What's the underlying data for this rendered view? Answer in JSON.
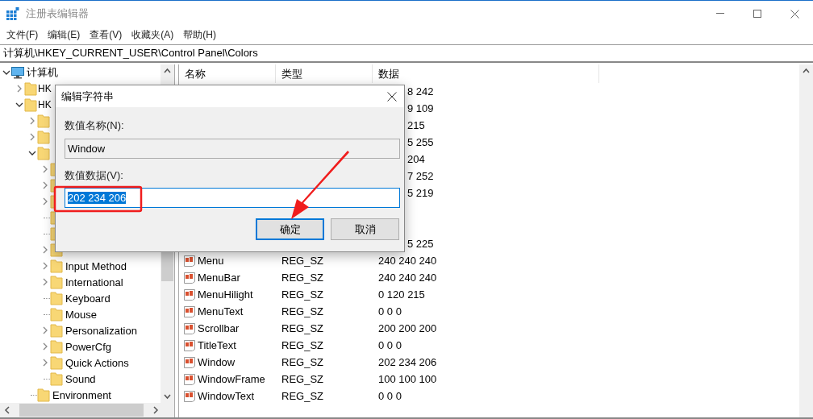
{
  "window": {
    "title": "注册表编辑器"
  },
  "menu": [
    "文件(F)",
    "编辑(E)",
    "查看(V)",
    "收藏夹(A)",
    "帮助(H)"
  ],
  "address": "计算机\\HKEY_CURRENT_USER\\Control Panel\\Colors",
  "tree": {
    "label": "计算机",
    "kind": "folder",
    "expanded": true,
    "children": [
      {
        "label": "HK",
        "kind": "folder",
        "expanded": false
      },
      {
        "label": "HK",
        "kind": "folder",
        "expanded": true,
        "children": [
          {
            "kind": "folder",
            "expanded": false
          },
          {
            "kind": "folder",
            "expanded": false
          },
          {
            "kind": "folder",
            "expanded": true,
            "children": [
              {
                "kind": "folder",
                "expanded": false
              },
              {
                "kind": "folder",
                "expanded": false
              },
              {
                "kind": "folder",
                "expanded": false
              },
              {
                "kind": "leaf"
              },
              {
                "kind": "leaf"
              },
              {
                "kind": "folder",
                "expanded": false
              },
              {
                "label": "Input Method",
                "kind": "folder",
                "expanded": false
              },
              {
                "label": "International",
                "kind": "folder",
                "expanded": false
              },
              {
                "label": "Keyboard",
                "kind": "leaf"
              },
              {
                "label": "Mouse",
                "kind": "leaf"
              },
              {
                "label": "Personalization",
                "kind": "folder",
                "expanded": false
              },
              {
                "label": "PowerCfg",
                "kind": "folder",
                "expanded": false
              },
              {
                "label": "Quick Actions",
                "kind": "folder",
                "expanded": false
              },
              {
                "label": "Sound",
                "kind": "leaf"
              }
            ]
          },
          {
            "label": "Environment",
            "kind": "leaf"
          }
        ]
      }
    ]
  },
  "list": {
    "columns": [
      "名称",
      "类型",
      "数据"
    ],
    "rows": [
      {
        "data": "8 242"
      },
      {
        "data": "9 109"
      },
      {
        "data": "215"
      },
      {
        "data": "5 255"
      },
      {
        "data": "204"
      },
      {
        "data": "7 252"
      },
      {
        "data": "5 219"
      },
      {},
      {},
      {
        "data": "5 225"
      },
      {
        "name": "Menu",
        "type": "REG_SZ",
        "data": "240 240 240"
      },
      {
        "name": "MenuBar",
        "type": "REG_SZ",
        "data": "240 240 240"
      },
      {
        "name": "MenuHilight",
        "type": "REG_SZ",
        "data": "0 120 215"
      },
      {
        "name": "MenuText",
        "type": "REG_SZ",
        "data": "0 0 0"
      },
      {
        "name": "Scrollbar",
        "type": "REG_SZ",
        "data": "200 200 200"
      },
      {
        "name": "TitleText",
        "type": "REG_SZ",
        "data": "0 0 0"
      },
      {
        "name": "Window",
        "type": "REG_SZ",
        "data": "202 234 206"
      },
      {
        "name": "WindowFrame",
        "type": "REG_SZ",
        "data": "100 100 100"
      },
      {
        "name": "WindowText",
        "type": "REG_SZ",
        "data": "0 0 0"
      }
    ]
  },
  "dialog": {
    "title": "编辑字符串",
    "name_label": "数值名称(N):",
    "name_value": "Window",
    "data_label": "数值数据(V):",
    "data_value": "202 234 206",
    "data_selected": true,
    "buttons": [
      {
        "label": "确定",
        "default": true
      },
      {
        "label": "取消",
        "default": false
      }
    ]
  }
}
